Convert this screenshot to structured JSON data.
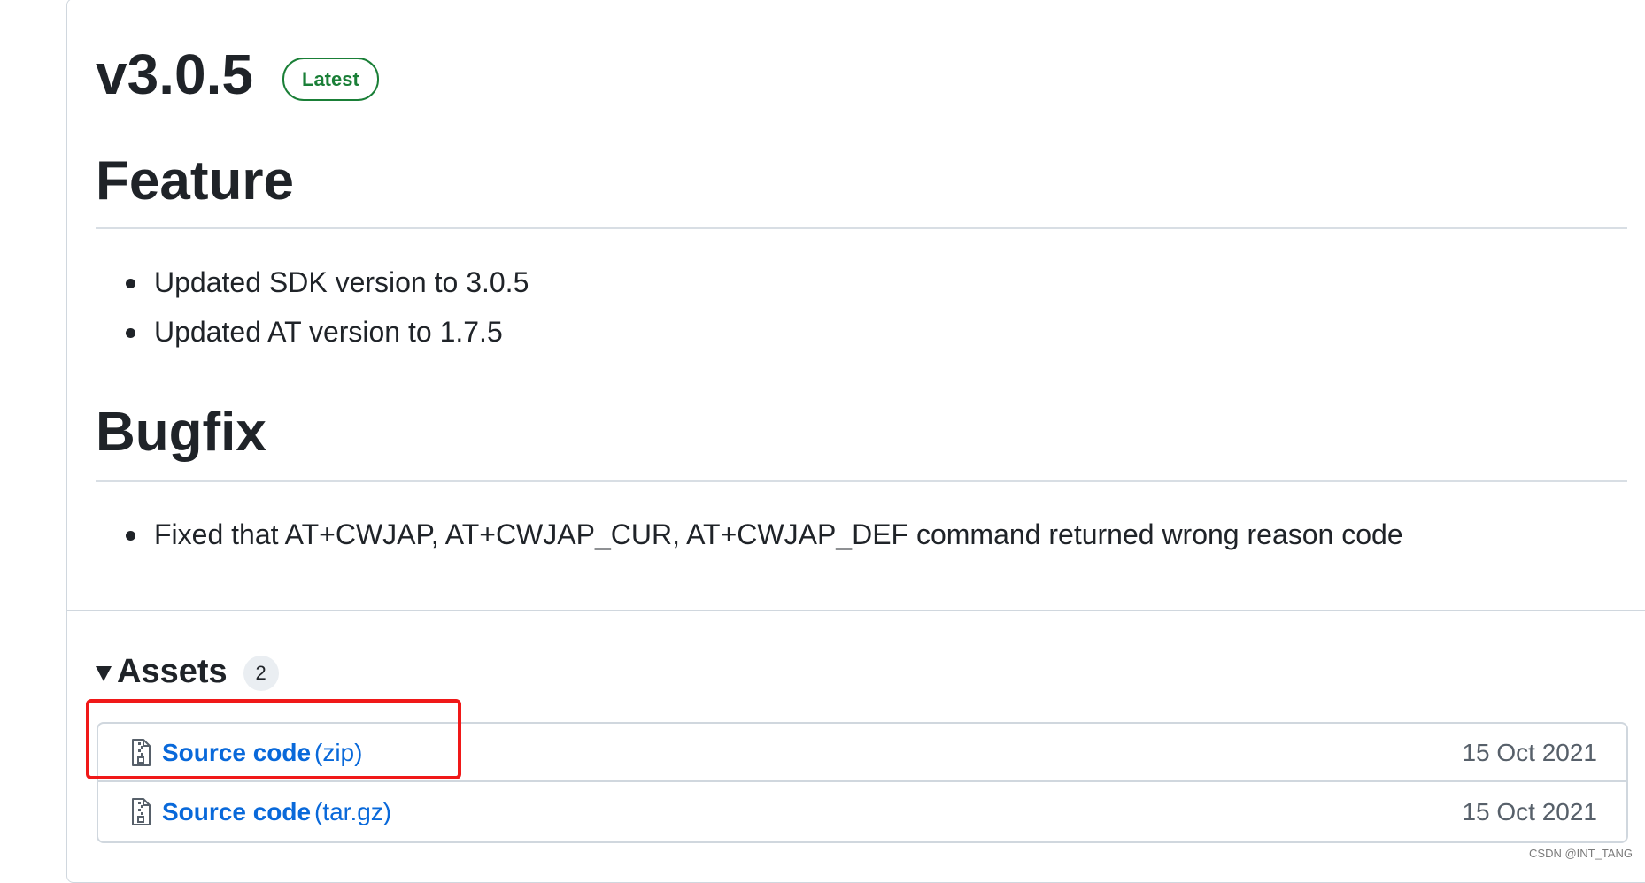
{
  "release": {
    "version": "v3.0.5",
    "badge": "Latest"
  },
  "sections": {
    "feature": {
      "heading": "Feature",
      "items": [
        "Updated SDK version to 3.0.5",
        "Updated AT version to 1.7.5"
      ]
    },
    "bugfix": {
      "heading": "Bugfix",
      "items": [
        "Fixed that AT+CWJAP, AT+CWJAP_CUR, AT+CWJAP_DEF command returned wrong reason code"
      ]
    }
  },
  "assets": {
    "title": "Assets",
    "count": "2",
    "items": [
      {
        "name": "Source code",
        "ext": "(zip)",
        "date": "15 Oct 2021",
        "icon": "file-zip-icon"
      },
      {
        "name": "Source code",
        "ext": "(tar.gz)",
        "date": "15 Oct 2021",
        "icon": "file-zip-icon"
      }
    ]
  },
  "annotation": {
    "color": "#f01818",
    "target": "Source code (zip)"
  },
  "colors": {
    "badge_green": "#1a7f37",
    "link_blue": "#0969da",
    "highlight_red": "#f01818"
  },
  "watermark": "CSDN @INT_TANG"
}
